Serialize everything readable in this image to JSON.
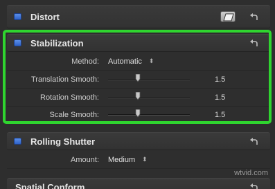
{
  "sections": {
    "distort": {
      "title": "Distort"
    },
    "stabilization": {
      "title": "Stabilization",
      "method": {
        "label": "Method:",
        "value": "Automatic"
      },
      "translation_smooth": {
        "label": "Translation Smooth:",
        "value": "1.5",
        "level": 0.35
      },
      "rotation_smooth": {
        "label": "Rotation Smooth:",
        "value": "1.5",
        "level": 0.35
      },
      "scale_smooth": {
        "label": "Scale Smooth:",
        "value": "1.5",
        "level": 0.35
      }
    },
    "rolling_shutter": {
      "title": "Rolling Shutter",
      "amount": {
        "label": "Amount:",
        "value": "Medium"
      }
    },
    "spatial_conform": {
      "title": "Spatial Conform"
    }
  },
  "popup_arrows": "⬍",
  "watermark": "wtvid.com",
  "colors": {
    "highlight": "#2fd52f",
    "checkbox": "#3b72d9",
    "background": "#2e2e2e"
  },
  "icons": {
    "reset": "reset-arrow-icon",
    "distort_shape": "parallelogram-icon",
    "checkbox": "enable-checkbox"
  }
}
